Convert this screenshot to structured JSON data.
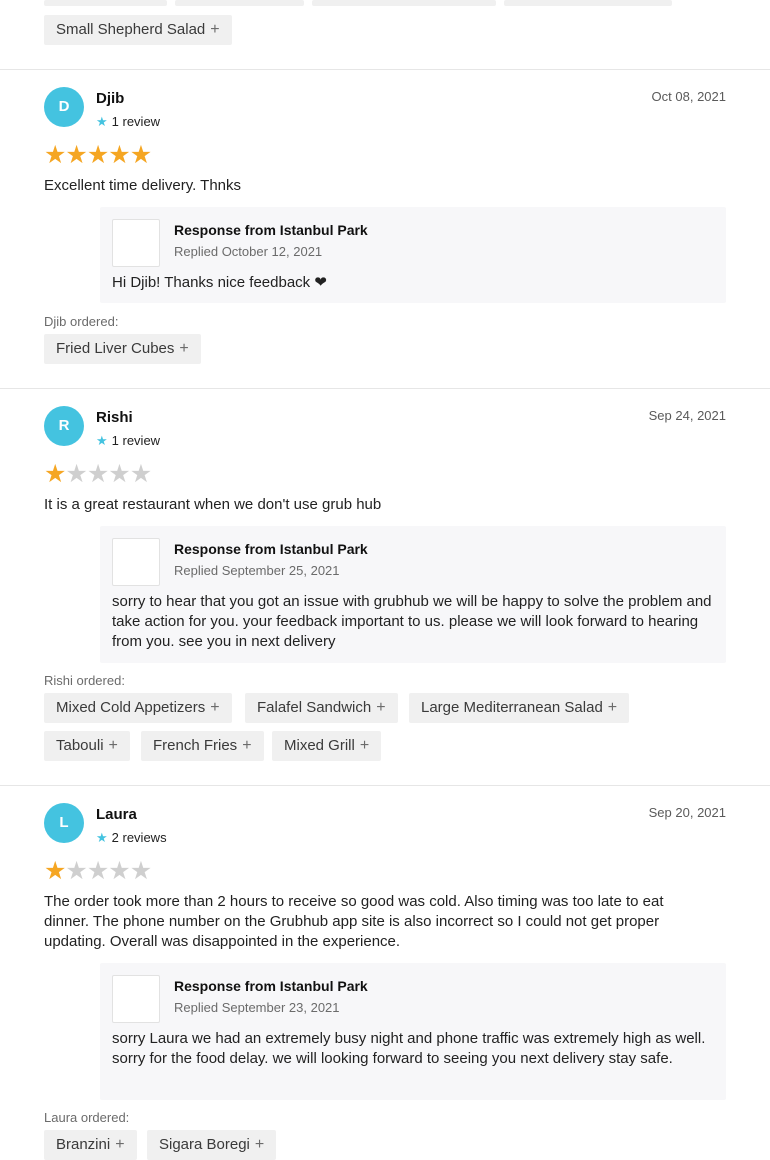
{
  "top_chips": [
    "Small Shepherd Salad"
  ],
  "plus_glyph": "+",
  "reviews": [
    {
      "initial": "D",
      "name": "Djib",
      "review_count": "1 review",
      "date": "Oct 08, 2021",
      "rating": 5,
      "text": "Excellent time delivery. Thnks",
      "response": {
        "title": "Response from Istanbul Park",
        "date": "Replied October 12, 2021",
        "text": "Hi Djib! Thanks nice feedback ❤"
      },
      "ordered_label": "Djib ordered:",
      "items": [
        "Fried Liver Cubes"
      ]
    },
    {
      "initial": "R",
      "name": "Rishi",
      "review_count": "1 review",
      "date": "Sep 24, 2021",
      "rating": 1,
      "text": "It is a great restaurant when we don't use grub hub",
      "response": {
        "title": "Response from Istanbul Park",
        "date": "Replied September 25, 2021",
        "text": "sorry to hear that you got an issue with grubhub we will be happy to solve the problem and take action for you. your feedback important to us. please we will look forward to hearing from you. see you in next delivery"
      },
      "ordered_label": "Rishi ordered:",
      "items": [
        "Mixed Cold Appetizers",
        "Falafel Sandwich",
        "Large Mediterranean Salad",
        "Tabouli",
        "French Fries",
        "Mixed Grill"
      ]
    },
    {
      "initial": "L",
      "name": "Laura",
      "review_count": "2 reviews",
      "date": "Sep 20, 2021",
      "rating": 1,
      "text": "The order took more than 2 hours to receive so good was cold. Also timing was too late to eat dinner. The phone number on the Grubhub app site is also incorrect so I could not get proper updating. Overall was disappointed in the experience.",
      "response": {
        "title": "Response from Istanbul Park",
        "date": "Replied September 23, 2021",
        "text": "sorry Laura we had an extremely busy night and phone traffic was extremely high as well. sorry for the food delay. we will looking forward to seeing you next delivery stay safe."
      },
      "ordered_label": "Laura ordered:",
      "items": [
        "Branzini",
        "Sigara Boregi"
      ]
    }
  ],
  "colors": {
    "avatar": "#44c3e0",
    "star_filled": "#f5a623",
    "star_empty": "#cfcfcf",
    "chip_bg": "#f0f0f0",
    "response_bg": "#f7f7f9"
  }
}
